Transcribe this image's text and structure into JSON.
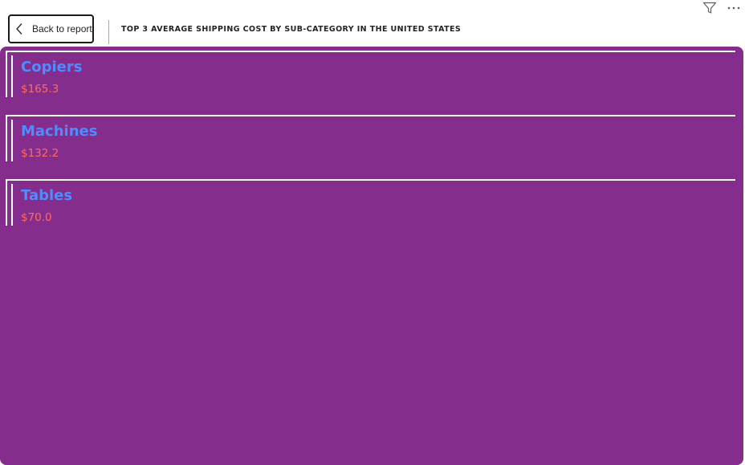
{
  "toolbar": {
    "back_label": "Back to report",
    "filter_icon": "filter-icon",
    "more_icon": "more-options-icon"
  },
  "visual": {
    "title": "TOP 3 AVERAGE SHIPPING COST BY SUB-CATEGORY IN THE UNITED STATES",
    "background_color": "#852d8c",
    "name_color": "#4e8cff",
    "value_color": "#ff6b5e",
    "items": [
      {
        "name": "Copiers",
        "value": "$165.3"
      },
      {
        "name": "Machines",
        "value": "$132.2"
      },
      {
        "name": "Tables",
        "value": "$70.0"
      }
    ]
  }
}
